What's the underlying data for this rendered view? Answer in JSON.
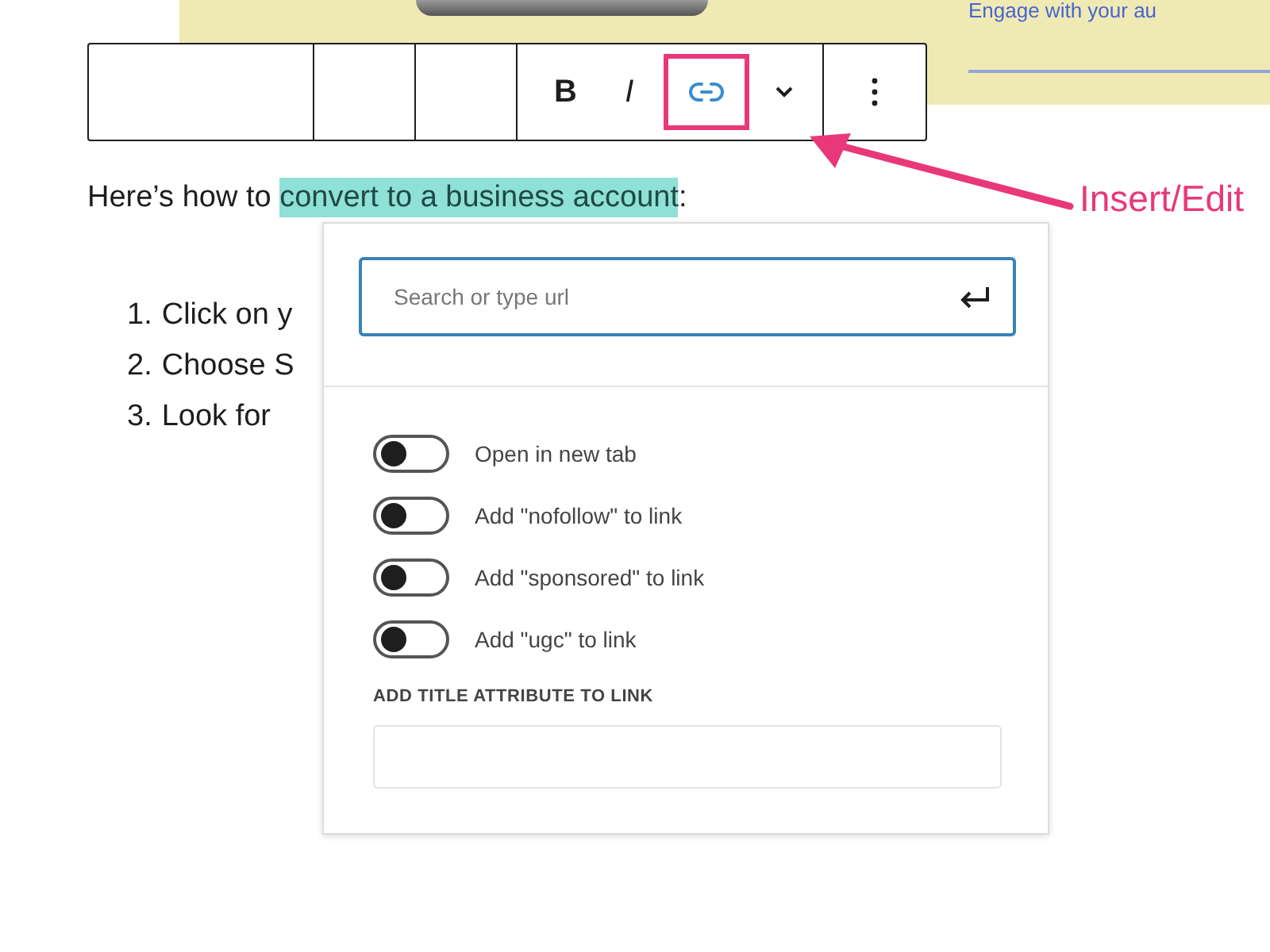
{
  "background_card": {
    "heading": "Engage with your au"
  },
  "toolbar": {
    "buttons": [
      {
        "kind": "text",
        "label": "B",
        "selected": false
      },
      {
        "kind": "text",
        "label": "I",
        "selected": false
      },
      {
        "kind": "link",
        "selected": true
      },
      {
        "kind": "chevron",
        "selected": false
      },
      {
        "kind": "kebab",
        "selected": false
      }
    ]
  },
  "annotation": {
    "label": "Insert/Edit"
  },
  "paragraph": {
    "segments": [
      {
        "text": "Here’s how to ",
        "highlighted": false
      },
      {
        "text": "convert to a business account",
        "highlighted": true
      },
      {
        "text": ":",
        "highlighted": false
      }
    ]
  },
  "steps": [
    {
      "number": "1.",
      "text": "Click on y"
    },
    {
      "number": "2.",
      "text": "Choose S"
    },
    {
      "number": "3.",
      "text": "Look for"
    }
  ],
  "link_popover": {
    "search": {
      "placeholder": "Search or type url"
    },
    "options": [
      {
        "label": "Open in new tab",
        "on": false
      },
      {
        "label": "Add \"nofollow\" to link",
        "on": false
      },
      {
        "label": "Add \"sponsored\" to link",
        "on": false
      },
      {
        "label": "Add \"ugc\" to link",
        "on": false
      }
    ],
    "title_attribute": {
      "label": "ADD TITLE ATTRIBUTE TO LINK"
    }
  }
}
